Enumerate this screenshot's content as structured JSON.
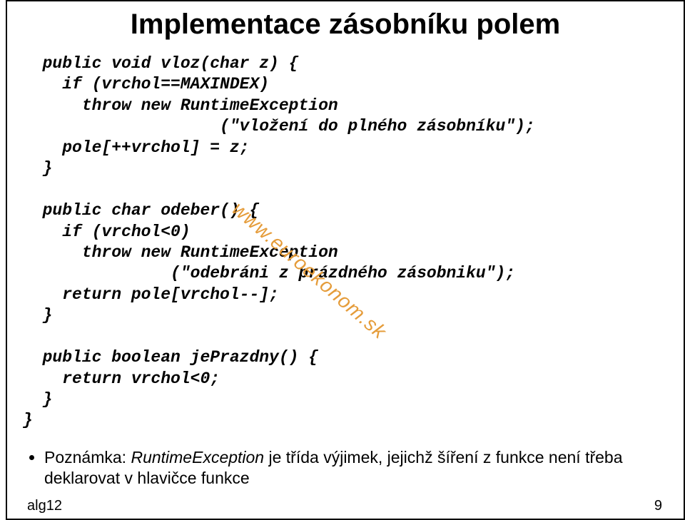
{
  "title": "Implementace zásobníku polem",
  "code": {
    "l1": "  public void vloz(char z) {",
    "l2": "    if (vrchol==MAXINDEX)",
    "l3": "      throw new RuntimeException",
    "l4": "                    (\"vložení do plného zásobníku\");",
    "l5": "    pole[++vrchol] = z;",
    "l6": "  }",
    "l7": "",
    "l8": "  public char odeber() {",
    "l9": "    if (vrchol<0)",
    "l10": "      throw new RuntimeException",
    "l11": "               (\"odebráni z prázdného zásobniku\");",
    "l12": "    return pole[vrchol--];",
    "l13": "  }",
    "l14": "",
    "l15": "  public boolean jePrazdny() {",
    "l16": "    return vrchol<0;",
    "l17": "  }",
    "l18": "}"
  },
  "watermark": "www.euroekonom.sk",
  "note_prefix": "Poznámka: ",
  "note_ital": "RuntimeException",
  "note_rest": " je třída výjimek, jejichž šíření z funkce není třeba deklarovat v hlavičce funkce",
  "footer_left": "alg12",
  "footer_right": "9"
}
